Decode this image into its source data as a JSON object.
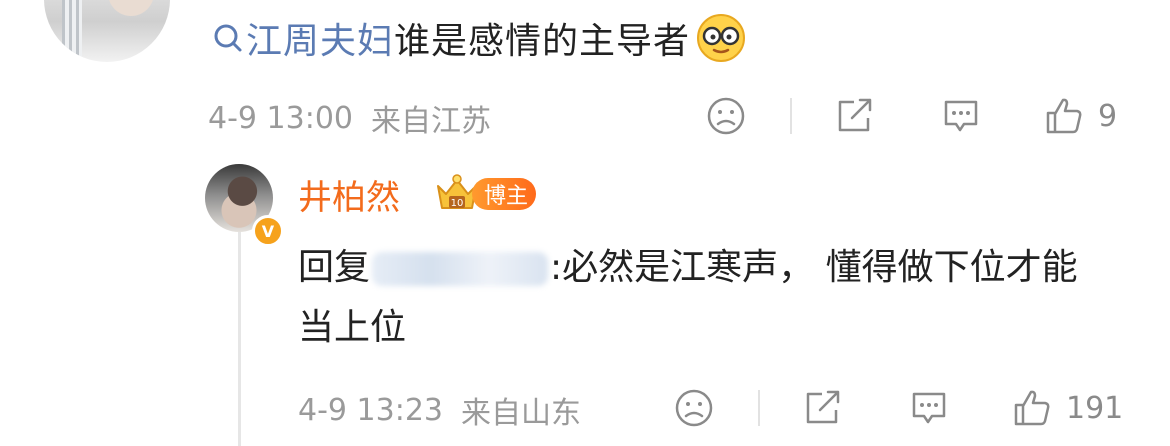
{
  "comment": {
    "topic_hashtag": "江周夫妇",
    "text": "谁是感情的主导者",
    "emoji_icon": "face-with-glasses-emoji",
    "time": "4-9 13:00",
    "location": "来自江苏",
    "likes": "9"
  },
  "reply": {
    "username": "井柏然",
    "badge_label": "博主",
    "verified_icon": "v-verified-badge",
    "prefix": "回复",
    "text": ":必然是江寒声， 懂得做下位才能当上位",
    "time": "4-9 13:23",
    "location": "来自山东",
    "likes": "191"
  },
  "colors": {
    "hashtag": "#5b7bb3",
    "username": "#f36b1c",
    "meta": "#9a9a9a",
    "icon": "#8a8a8a"
  }
}
